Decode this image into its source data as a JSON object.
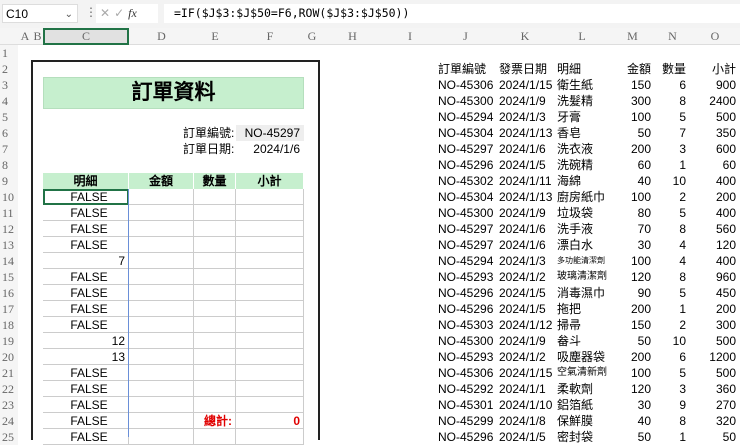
{
  "formula_bar": {
    "name_box": "C10",
    "fx": "fx",
    "formula": "=IF($J$3:$J$50=F6,ROW($J$3:$J$50))"
  },
  "columns": [
    "A",
    "B",
    "C",
    "D",
    "E",
    "F",
    "G",
    "H",
    "I",
    "J",
    "K",
    "L",
    "M",
    "N",
    "O"
  ],
  "rows": [
    "1",
    "2",
    "3",
    "4",
    "5",
    "6",
    "7",
    "8",
    "9",
    "10",
    "11",
    "12",
    "13",
    "14",
    "15",
    "16",
    "17",
    "18",
    "19",
    "20",
    "21",
    "22",
    "23",
    "24",
    "25"
  ],
  "form": {
    "title": "訂單資料",
    "order_no_label": "訂單編號:",
    "order_no": "NO-45297",
    "order_date_label": "訂單日期:",
    "order_date": "2024/1/6",
    "headers": [
      "明細",
      "金額",
      "數量",
      "小計"
    ],
    "c_values": [
      "FALSE",
      "FALSE",
      "FALSE",
      "FALSE",
      "7",
      "FALSE",
      "FALSE",
      "FALSE",
      "FALSE",
      "12",
      "13",
      "FALSE",
      "FALSE",
      "FALSE",
      "FALSE",
      "FALSE"
    ],
    "total_label": "總計:",
    "total": "0"
  },
  "data": {
    "headers": [
      "訂單編號",
      "發票日期",
      "明細",
      "金額",
      "數量",
      "小計"
    ],
    "rows": [
      [
        "NO-45306",
        "2024/1/15",
        "衛生紙",
        "150",
        "6",
        "900"
      ],
      [
        "NO-45300",
        "2024/1/9",
        "洗髮精",
        "300",
        "8",
        "2400"
      ],
      [
        "NO-45294",
        "2024/1/3",
        "牙膏",
        "100",
        "5",
        "500"
      ],
      [
        "NO-45304",
        "2024/1/13",
        "香皂",
        "50",
        "7",
        "350"
      ],
      [
        "NO-45297",
        "2024/1/6",
        "洗衣液",
        "200",
        "3",
        "600"
      ],
      [
        "NO-45296",
        "2024/1/5",
        "洗碗精",
        "60",
        "1",
        "60"
      ],
      [
        "NO-45302",
        "2024/1/11",
        "海綿",
        "40",
        "10",
        "400"
      ],
      [
        "NO-45304",
        "2024/1/13",
        "廚房紙巾",
        "100",
        "2",
        "200"
      ],
      [
        "NO-45300",
        "2024/1/9",
        "垃圾袋",
        "80",
        "5",
        "400"
      ],
      [
        "NO-45297",
        "2024/1/6",
        "洗手液",
        "70",
        "8",
        "560"
      ],
      [
        "NO-45297",
        "2024/1/6",
        "漂白水",
        "30",
        "4",
        "120"
      ],
      [
        "NO-45294",
        "2024/1/3",
        "多功能清潔劑",
        "100",
        "4",
        "400"
      ],
      [
        "NO-45293",
        "2024/1/2",
        "玻璃清潔劑",
        "120",
        "8",
        "960"
      ],
      [
        "NO-45296",
        "2024/1/5",
        "消毒濕巾",
        "90",
        "5",
        "450"
      ],
      [
        "NO-45296",
        "2024/1/5",
        "拖把",
        "200",
        "1",
        "200"
      ],
      [
        "NO-45303",
        "2024/1/12",
        "掃帚",
        "150",
        "2",
        "300"
      ],
      [
        "NO-45300",
        "2024/1/9",
        "畚斗",
        "50",
        "10",
        "500"
      ],
      [
        "NO-45293",
        "2024/1/2",
        "吸塵器袋",
        "200",
        "6",
        "1200"
      ],
      [
        "NO-45306",
        "2024/1/15",
        "空氣清新劑",
        "100",
        "5",
        "500"
      ],
      [
        "NO-45292",
        "2024/1/1",
        "柔軟劑",
        "120",
        "3",
        "360"
      ],
      [
        "NO-45301",
        "2024/1/10",
        "鋁箔紙",
        "30",
        "9",
        "270"
      ],
      [
        "NO-45299",
        "2024/1/8",
        "保鮮膜",
        "40",
        "8",
        "320"
      ],
      [
        "NO-45296",
        "2024/1/5",
        "密封袋",
        "50",
        "1",
        "50"
      ]
    ]
  }
}
